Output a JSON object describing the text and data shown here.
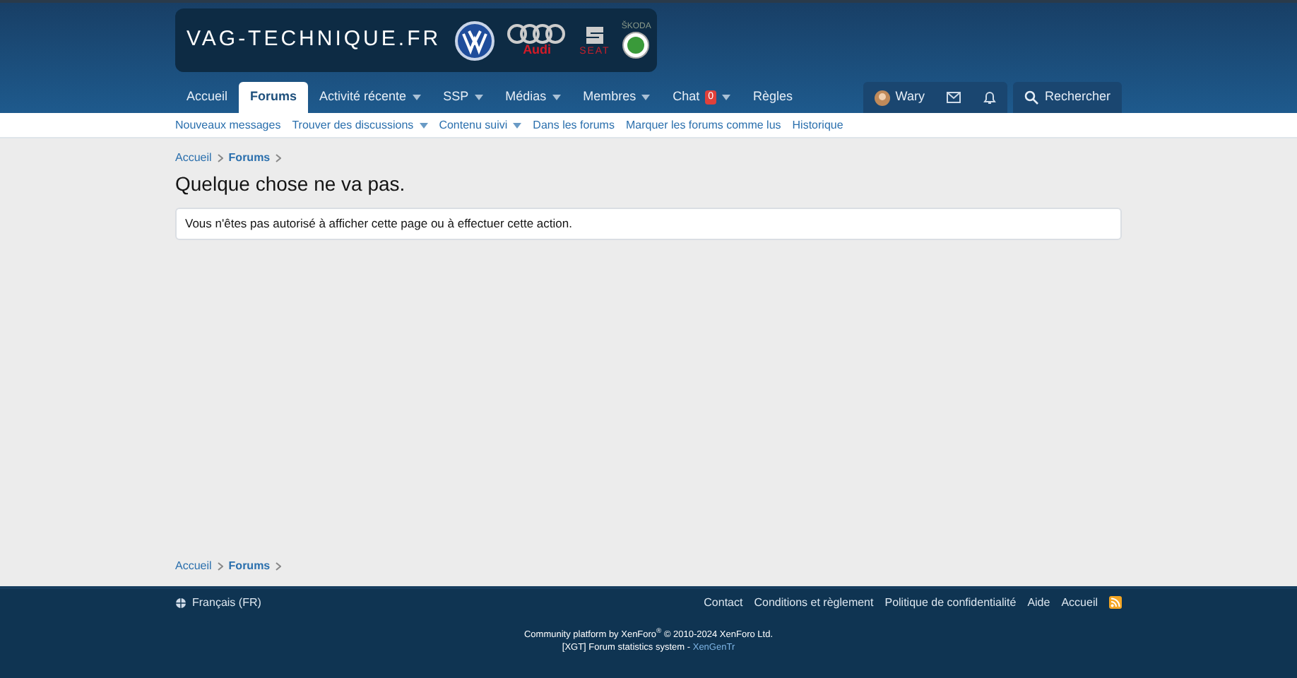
{
  "logo": {
    "title": "VAG-TECHNIQUE.FR",
    "brands": [
      {
        "kind": "vw"
      },
      {
        "kind": "audi",
        "text": "Audi"
      },
      {
        "kind": "seat",
        "text": "SEAT"
      },
      {
        "kind": "skoda",
        "text": "ŠKODA"
      }
    ]
  },
  "nav": {
    "tabs": [
      {
        "label": "Accueil",
        "selected": false,
        "dropdown": false
      },
      {
        "label": "Forums",
        "selected": true,
        "dropdown": false
      },
      {
        "label": "Activité récente",
        "selected": false,
        "dropdown": true
      },
      {
        "label": "SSP",
        "selected": false,
        "dropdown": true
      },
      {
        "label": "Médias",
        "selected": false,
        "dropdown": true
      },
      {
        "label": "Membres",
        "selected": false,
        "dropdown": true
      },
      {
        "label": "Chat",
        "selected": false,
        "dropdown": true,
        "badge": "0"
      },
      {
        "label": "Règles",
        "selected": false,
        "dropdown": false
      }
    ],
    "user": "Wary",
    "search": "Rechercher"
  },
  "subnav": [
    {
      "label": "Nouveaux messages",
      "dropdown": false
    },
    {
      "label": "Trouver des discussions",
      "dropdown": true
    },
    {
      "label": "Contenu suivi",
      "dropdown": true
    },
    {
      "label": "Dans les forums",
      "dropdown": false
    },
    {
      "label": "Marquer les forums comme lus",
      "dropdown": false
    },
    {
      "label": "Historique",
      "dropdown": false
    }
  ],
  "breadcrumb_top": [
    {
      "label": "Accueil",
      "current": false
    },
    {
      "label": "Forums",
      "current": true
    }
  ],
  "title": "Quelque chose ne va pas.",
  "message": "Vous n'êtes pas autorisé à afficher cette page ou à effectuer cette action.",
  "breadcrumb_bottom": [
    {
      "label": "Accueil",
      "current": false
    },
    {
      "label": "Forums",
      "current": true
    }
  ],
  "footer": {
    "language": "Français (FR)",
    "links": [
      "Contact",
      "Conditions et règlement",
      "Politique de confidentialité",
      "Aide",
      "Accueil"
    ],
    "copyright": "Community platform by XenForo$^{®}$ © 2010-2024 XenForo Ltd.",
    "addon": {
      "text": "[XGT] Forum statistics system - ",
      "link": "XenGenTr"
    }
  }
}
